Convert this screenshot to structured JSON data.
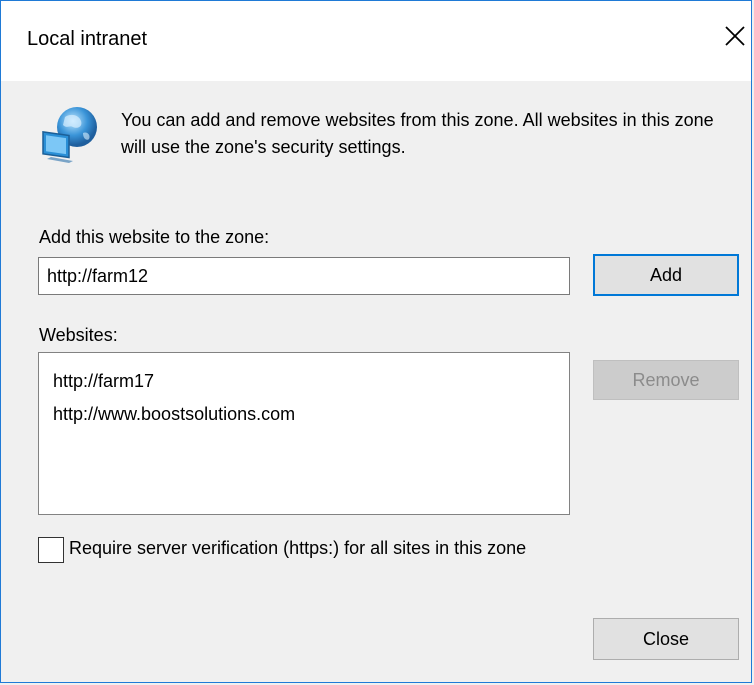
{
  "window": {
    "title": "Local intranet"
  },
  "info_text": "You can add and remove websites from this zone. All websites in this zone will use the zone's security settings.",
  "add_section": {
    "label": "Add this website to the zone:",
    "input_value": "http://farm12",
    "add_button": "Add"
  },
  "websites_section": {
    "label": "Websites:",
    "items": [
      {
        "url": "http://farm17"
      },
      {
        "url": "http://www.boostsolutions.com"
      }
    ],
    "remove_button": "Remove"
  },
  "checkbox": {
    "label": "Require server verification (https:) for all sites in this zone",
    "checked": false
  },
  "close_button": "Close",
  "icons": {
    "zone_icon": "globe-computer-icon",
    "close_icon": "close-icon"
  },
  "colors": {
    "accent": "#0078d7",
    "window_border": "#1f7ad6"
  }
}
